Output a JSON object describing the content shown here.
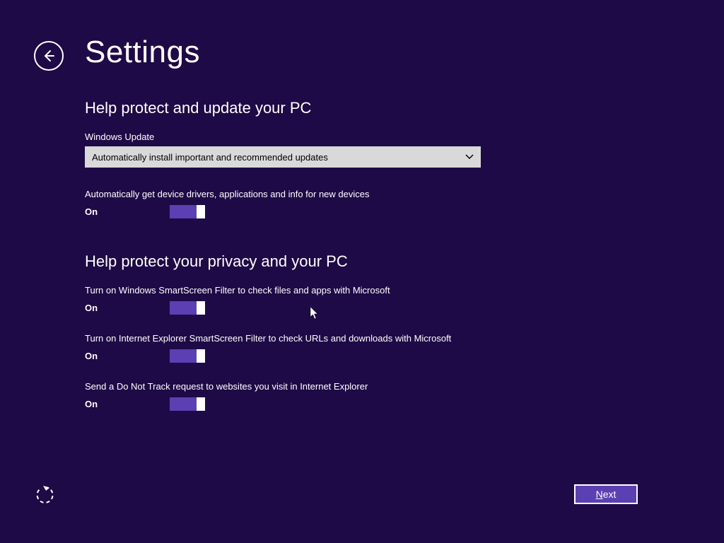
{
  "header": {
    "title": "Settings"
  },
  "section1": {
    "title": "Help protect and update your PC",
    "wu_label": "Windows Update",
    "wu_selected": "Automatically install important and recommended updates",
    "devices_desc": "Automatically get device drivers, applications and info for new devices",
    "devices_state": "On"
  },
  "section2": {
    "title": "Help protect your privacy and your PC",
    "ss_desc": "Turn on Windows SmartScreen Filter to check files and apps with Microsoft",
    "ss_state": "On",
    "ie_desc": "Turn on Internet Explorer SmartScreen Filter to check URLs and downloads with Microsoft",
    "ie_state": "On",
    "dnt_desc": "Send a Do Not Track request to websites you visit in Internet Explorer",
    "dnt_state": "On"
  },
  "footer": {
    "next_label": "Next",
    "next_underline": "N"
  }
}
